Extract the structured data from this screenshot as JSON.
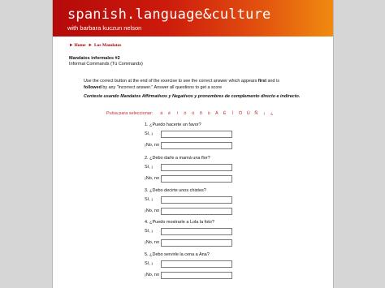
{
  "site": {
    "title": "spanish.language&culture",
    "tagline": "with barbara kuczun nelson"
  },
  "breadcrumb": {
    "home": "Home",
    "section": "Los Mandatos"
  },
  "exercise": {
    "title": "Mandatos informales #2",
    "subtitle": "Informal Commands (Tú Commands)"
  },
  "instructions": {
    "part1": "Use the correct button at the end of the exercise to see the correct answer which appears ",
    "first": "first",
    "part2": " and is ",
    "followed": "followed",
    "part3": " by any \"incorrect answer.\" Answer all questions to get a score"
  },
  "directive": {
    "part1": "Conteste usando ",
    "em1": "Mandatos Affirmativos y Negativos",
    "part2": " y pronombres de complemento directo e indirecto."
  },
  "charpicker": {
    "label": "Pulsa para seleccionar:",
    "chars": [
      "á",
      "é",
      "í",
      "ó",
      "ú",
      "ñ",
      "ü",
      "Á",
      "É",
      "Í",
      "Ó",
      "Ú",
      "Ñ",
      "¡",
      "¿"
    ]
  },
  "questions": [
    {
      "text": "1. ¿Puedo hacerte un favor?",
      "si_label": "Sí, ¡",
      "si_value": "",
      "no_label": "¡No, no",
      "no_value": ""
    },
    {
      "text": "2. ¿Debo darle a mamá una flor?",
      "si_label": "Sí, ¡",
      "si_value": "",
      "no_label": "¡No, no",
      "no_value": ""
    },
    {
      "text": "3. ¿Debo decirte unos chistes?",
      "si_label": "Sí, ¡",
      "si_value": "",
      "no_label": "¡No, no",
      "no_value": ""
    },
    {
      "text": "4. ¿Puedo mostrarle a Lola la foto?",
      "si_label": "Sí, ¡",
      "si_value": "",
      "no_label": "¡No, no",
      "no_value": ""
    },
    {
      "text": "5. ¿Debo servirle la cena a Ana?",
      "si_label": "Sí, ¡",
      "si_value": "",
      "no_label": "¡No, no",
      "no_value": ""
    }
  ],
  "colors": {
    "banner_start": "#b40a0a",
    "banner_end": "#f08a10",
    "link": "#a80000",
    "charpicker": "#c62828"
  }
}
